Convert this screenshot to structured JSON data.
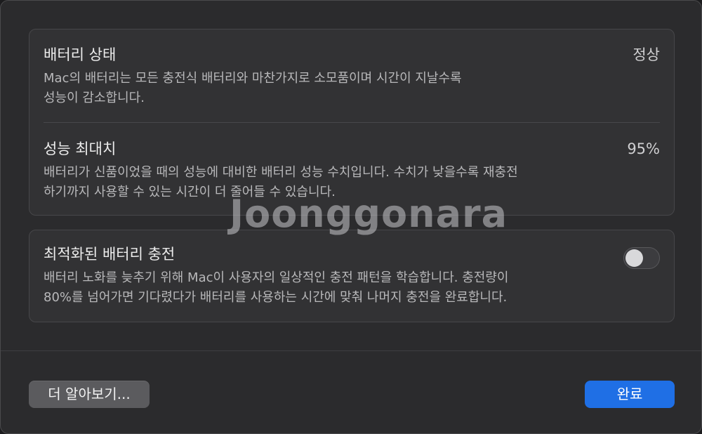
{
  "battery_health": {
    "status": {
      "title": "배터리 상태",
      "value": "정상",
      "description_lines": [
        "Mac의 배터리는 모든 충전식 배터리와 마찬가지로 소모품이며 시간이 지날수록",
        "성능이 감소합니다."
      ]
    },
    "capacity": {
      "title": "성능 최대치",
      "value": "95%",
      "description_lines": [
        "배터리가 신품이었을 때의 성능에 대비한 배터리 성능 수치입니다. 수치가 낮을수록 재충전",
        "하기까지 사용할 수 있는 시간이 더 줄어들 수 있습니다."
      ]
    }
  },
  "optimized_charging": {
    "title": "최적화된 배터리 충전",
    "enabled": false,
    "description_lines": [
      "배터리 노화를 늦추기 위해 Mac이 사용자의 일상적인 충전 패턴을 학습합니다. 충전량이",
      "80%를 넘어가면 기다렸다가 배터리를 사용하는 시간에 맞춰 나머지 충전을 완료합니다."
    ]
  },
  "watermark": "Joonggonara",
  "footer": {
    "learn_more_label": "더 알아보기...",
    "done_label": "완료"
  },
  "colors": {
    "accent": "#1f6fe5",
    "dialog_bg": "#2b2b2d",
    "group_bg": "#323234"
  }
}
